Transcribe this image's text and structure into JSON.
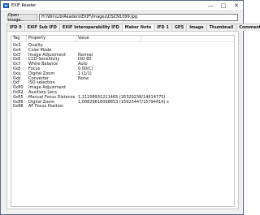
{
  "window": {
    "title": "EXIF Reader"
  },
  "toolbar": {
    "open_label": "Open image...",
    "path_value": "H:\\Win\\Lib\\Readers\\EXIF\\Images\\DSCN1099.jpg"
  },
  "tabs": [
    {
      "label": "IFD 0"
    },
    {
      "label": "EXIF Sub IFD"
    },
    {
      "label": "EXIF Interoperability IFD"
    },
    {
      "label": "Maker Note",
      "active": true
    },
    {
      "label": "IFD 1"
    },
    {
      "label": "GPS"
    },
    {
      "label": "Image"
    },
    {
      "label": "Thumbnail"
    },
    {
      "label": "Comment"
    }
  ],
  "table": {
    "headers": {
      "tag": "Tag",
      "property": "Property",
      "value": "Value"
    },
    "rows": [
      {
        "tag": "0x3",
        "property": "Quality",
        "value": ""
      },
      {
        "tag": "0x4",
        "property": "Color Mode",
        "value": ""
      },
      {
        "tag": "0x5",
        "property": "Image Adjustment",
        "value": "Normal"
      },
      {
        "tag": "0x6",
        "property": "CCD Sensitivity",
        "value": "ISO 80"
      },
      {
        "tag": "0x7",
        "property": "White Balance",
        "value": "Auto"
      },
      {
        "tag": "0x8",
        "property": "Focus",
        "value": "0.00(C)"
      },
      {
        "tag": "0xa",
        "property": "Digital Zoom",
        "value": "1 (1/1)"
      },
      {
        "tag": "0xb",
        "property": "Converter",
        "value": "None"
      },
      {
        "tag": "0xf",
        "property": "ISO selection",
        "value": ""
      },
      {
        "tag": "0x80",
        "property": "Image Adjustment",
        "value": ""
      },
      {
        "tag": "0x82",
        "property": "Auxiliary Lens",
        "value": ""
      },
      {
        "tag": "0x85",
        "property": "Manual Focus Distance",
        "value": "1,11208931211465 (26329238/14614775)"
      },
      {
        "tag": "0x86",
        "property": "Digital Zoom",
        "value": "1,00829616098853 (15925447/15794414) x"
      },
      {
        "tag": "0x88",
        "property": "AF Focus Position",
        "value": ""
      }
    ]
  }
}
